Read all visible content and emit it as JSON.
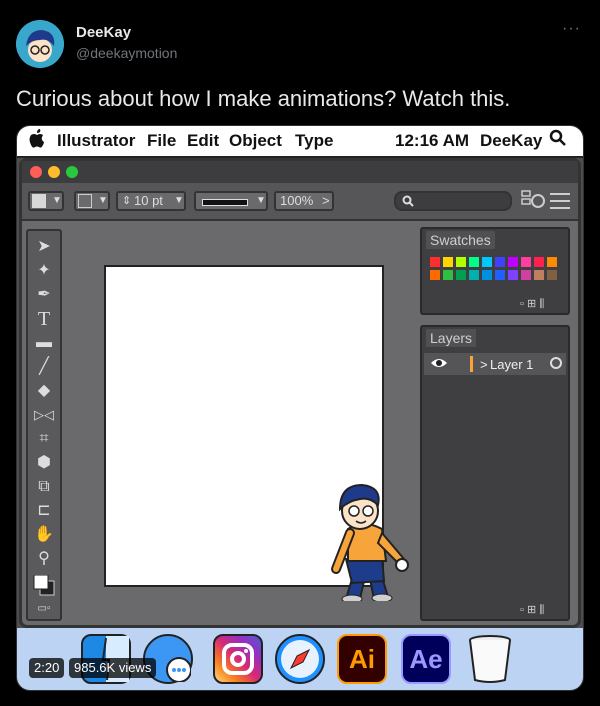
{
  "tweet": {
    "display_name": "DeeKay",
    "handle": "@deekaymotion",
    "more_icon": "···",
    "text": "Curious about how I make animations? Watch this."
  },
  "menubar": {
    "app": "Illustrator",
    "items": [
      "File",
      "Edit",
      "Object",
      "Type"
    ],
    "time": "12:16 AM",
    "user": "DeeKay"
  },
  "toolbar": {
    "stroke_size": "10 pt",
    "zoom": "100%"
  },
  "panels": {
    "swatches_title": "Swatches",
    "layers_title": "Layers",
    "layer_name": "Layer 1",
    "layer_arrow": ">"
  },
  "dock": {
    "ai_label": "Ai",
    "ae_label": "Ae"
  },
  "video": {
    "duration": "2:20",
    "views": "985.6K views"
  },
  "colors": {
    "swatches_row1": [
      "#ff2d2d",
      "#ffd400",
      "#b2ff00",
      "#00ff88",
      "#00c8ff",
      "#4040ff",
      "#c000ff",
      "#ff3fa0",
      "#ff2050",
      "#ff8a00"
    ],
    "swatches_row2": [
      "#ff6a00",
      "#30c040",
      "#00a050",
      "#00b0b0",
      "#0090e0",
      "#2060ff",
      "#8040ff",
      "#d040a0",
      "#c08060",
      "#806040"
    ]
  }
}
